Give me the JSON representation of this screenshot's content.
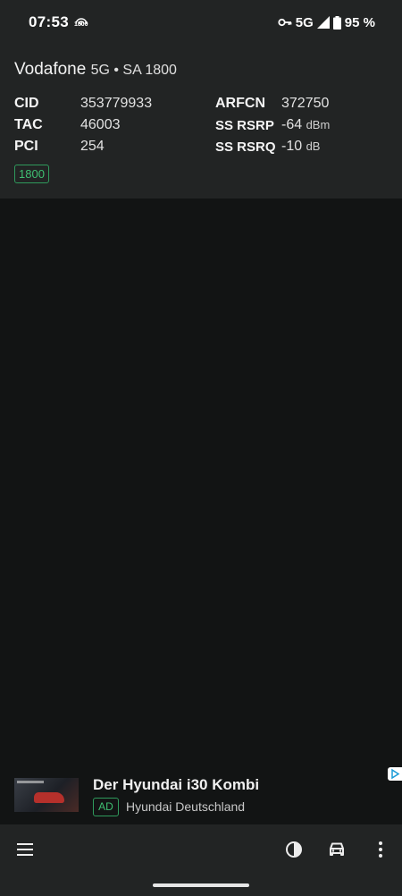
{
  "status_bar": {
    "time": "07:53",
    "badge": "1800",
    "network": "5G",
    "battery": "95 %"
  },
  "cell": {
    "operator": "Vodafone",
    "technology": "5G • SA 1800",
    "rows_left": [
      {
        "label": "CID",
        "value": "353779933"
      },
      {
        "label": "TAC",
        "value": "46003"
      },
      {
        "label": "PCI",
        "value": "254"
      }
    ],
    "rows_right": [
      {
        "label": "ARFCN",
        "value": "372750",
        "unit": ""
      },
      {
        "label": "SS RSRP",
        "value": "-64",
        "unit": "dBm"
      },
      {
        "label": "SS RSRQ",
        "value": "-10",
        "unit": "dB"
      }
    ],
    "band_chip": "1800",
    "accent_color": "#3fbf72"
  },
  "ad": {
    "title": "Der Hyundai i30 Kombi",
    "chip": "AD",
    "advertiser": "Hyundai Deutschland"
  },
  "bottom_nav": {
    "icons": [
      "menu-icon",
      "contrast-icon",
      "car-icon",
      "more-vertical-icon"
    ]
  }
}
